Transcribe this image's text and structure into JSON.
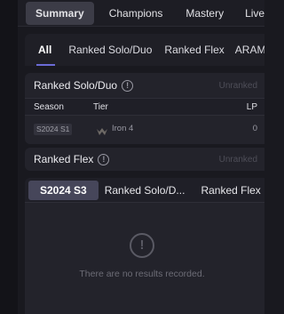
{
  "top_tabs": [
    "Summary",
    "Champions",
    "Mastery",
    "Live G"
  ],
  "sub_tabs": [
    "All",
    "Ranked Solo/Duo",
    "Ranked Flex",
    "ARAM"
  ],
  "solo_card": {
    "title": "Ranked Solo/Duo",
    "status": "Unranked",
    "columns": {
      "season": "Season",
      "tier": "Tier",
      "lp": "LP"
    },
    "row": {
      "season": "S2024 S1",
      "tier": "Iron 4",
      "lp": "0"
    }
  },
  "flex_card": {
    "title": "Ranked Flex",
    "status": "Unranked"
  },
  "history_card": {
    "tabs": [
      "S2024 S3",
      "Ranked Solo/D...",
      "Ranked Flex"
    ],
    "empty_message": "There are no results recorded."
  },
  "icons": {
    "info": "info-icon",
    "tier": "iron-tier-icon",
    "empty": "exclamation-circle-icon"
  },
  "colors": {
    "accent": "#6b6bd6",
    "background": "#19191f",
    "card": "#23232b"
  }
}
